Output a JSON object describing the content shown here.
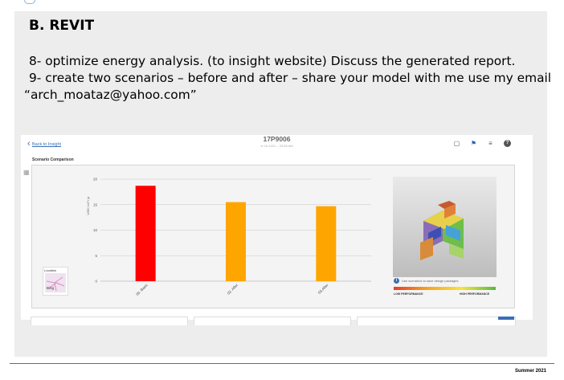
{
  "slide": {
    "heading": "B. REVIT",
    "lines": [
      "8- optimize energy analysis. (to insight website) Discuss the generated report.",
      "9- create two scenarios – before and after – share your model with me use my email",
      "“arch_moataz@yahoo.com”"
    ]
  },
  "screenshot": {
    "back_link": "Back to Insight",
    "project_title": "17P9006",
    "project_date": "4/ 16 2021 – 03:35 AM",
    "section_title": "Scenario Comparison",
    "toolbar_icons": [
      "comments-icon",
      "flag-icon",
      "layers-icon",
      "help-icon"
    ],
    "location_label": "Location",
    "bing_label": "Bing",
    "info_text": "Use scenarios to save design packages",
    "perf_low": "LOW PERFORMANCE",
    "perf_high": "HIGH PERFORMANCE"
  },
  "chart_data": {
    "type": "bar",
    "ylabel": "USD / m² / yr",
    "ylim": [
      0,
      20
    ],
    "yticks": [
      0,
      5,
      10,
      15,
      20
    ],
    "categories": [
      "00. Basic",
      "02. After",
      "03.After"
    ],
    "values": [
      18.7,
      15.5,
      14.7
    ],
    "colors": [
      "#ff0000",
      "#ffa500",
      "#ffa500"
    ],
    "grid": true
  },
  "footer": {
    "text": "Summer 2021"
  }
}
